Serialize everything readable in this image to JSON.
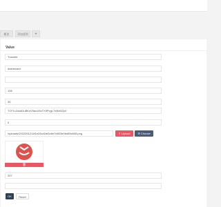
{
  "tabs": [
    {
      "label": "概览"
    },
    {
      "label": "添加规则"
    },
    {
      "label": "+"
    }
  ],
  "panel": {
    "title": "Value"
  },
  "form": {
    "fields": [
      {
        "value": "Transfer"
      },
      {
        "value": "dashboard"
      },
      {
        "value": ""
      },
      {
        "value": "106"
      },
      {
        "value": "30"
      },
      {
        "value": "TCFLL5du62uBKoV5aoU5zTX9PvgL7dWz5ZyV"
      },
      {
        "value": "0"
      },
      {
        "value": "/uploads/20220512/181e33cd2af1b6e7e803e0bd89c608.png"
      },
      {
        "value": "207"
      },
      {
        "value": ""
      }
    ],
    "upload_label": "Upload",
    "choose_label": "Choose",
    "delete_icon": "trash-icon",
    "ok_label": "OK",
    "reset_label": "Reset"
  },
  "colors": {
    "danger": "#ed5565",
    "primary_dark": "#2f4050",
    "choose": "#4a5b7a",
    "logo_red": "#d9534f"
  }
}
